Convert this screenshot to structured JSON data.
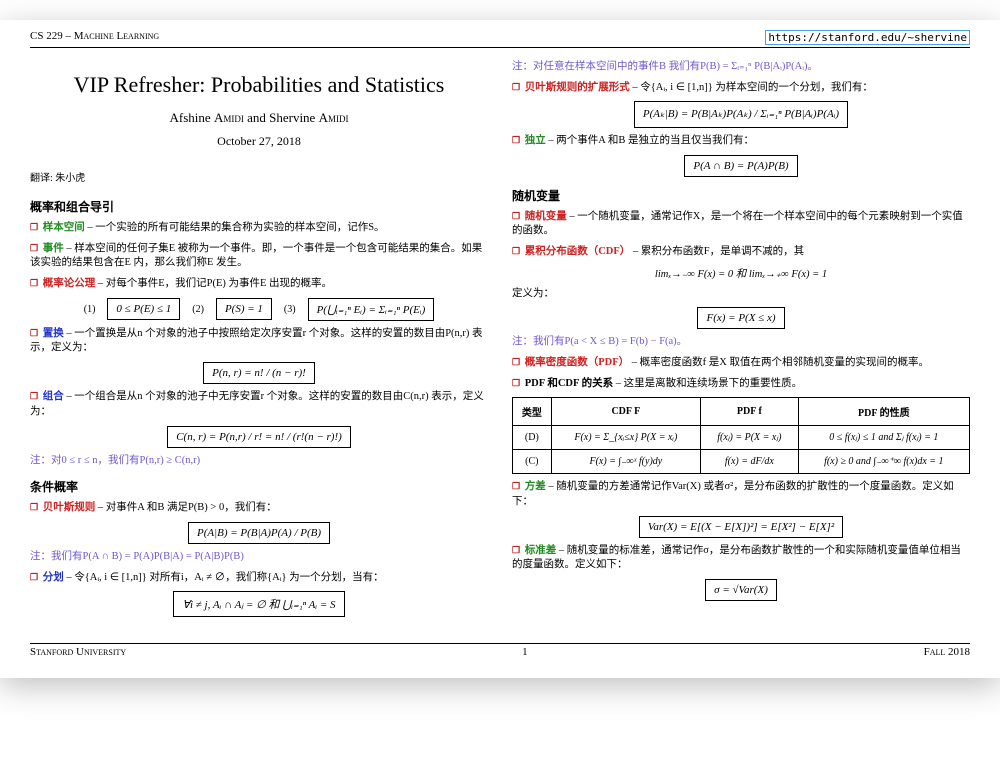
{
  "header": {
    "course": "CS 229 – Machine Learning",
    "url": "https://stanford.edu/~shervine"
  },
  "title": "VIP Refresher: Probabilities and Statistics",
  "authors": "Afshine Amidi and Shervine Amidi",
  "date": "October 27, 2018",
  "translator": "翻译: 朱小虎",
  "left": {
    "sec1": "概率和组合导引",
    "samplespace": {
      "term": "样本空间",
      "text": " – 一个实验的所有可能结果的集合称为实验的样本空间，记作S。"
    },
    "event": {
      "term": "事件",
      "text": " – 样本空间的任何子集E 被称为一个事件。即，一个事件是一个包含可能结果的集合。如果该实验的结果包含在E 内，那么我们称E 发生。"
    },
    "axioms": {
      "term": "概率论公理",
      "text": " – 对每个事件E，我们记P(E) 为事件E 出现的概率。"
    },
    "ax1": "(1)",
    "axbox1": "0 ≤ P(E) ≤ 1",
    "ax2": "(2)",
    "axbox2": "P(S) = 1",
    "ax3": "(3)",
    "axbox3": "P(⋃ᵢ₌₁ⁿ Eᵢ) = Σᵢ₌₁ⁿ P(Eᵢ)",
    "perm": {
      "term": "置换",
      "text": " – 一个置换是从n 个对象的池子中按照给定次序安置r 个对象。这样的安置的数目由P(n,r) 表示，定义为："
    },
    "permbox": "P(n, r) = n! / (n − r)!",
    "comb": {
      "term": "组合",
      "text": " – 一个组合是从n 个对象的池子中无序安置r 个对象。这样的安置的数目由C(n,r) 表示，定义为："
    },
    "combbox": "C(n, r) = P(n,r) / r! = n! / (r!(n − r)!)",
    "note1": "注：对0 ≤ r ≤ n，我们有P(n,r) ≥ C(n,r)",
    "sec2": "条件概率",
    "bayes": {
      "term": "贝叶斯规则",
      "text": " – 对事件A 和B 满足P(B) > 0，我们有："
    },
    "bayesbox": "P(A|B) = P(B|A)P(A) / P(B)",
    "note2": "注：我们有P(A ∩ B) = P(A)P(B|A) = P(A|B)P(B)",
    "partition": {
      "term": "分划",
      "text": " – 令{Aᵢ, i ∈ [1,n]} 对所有i，Aᵢ ≠ ∅，我们称{Aᵢ} 为一个分划，当有："
    },
    "partitionbox": "∀i ≠ j, Aᵢ ∩ Aⱼ = ∅    和    ⋃ᵢ₌₁ⁿ Aᵢ = S"
  },
  "right": {
    "note3": "注：对任意在样本空间中的事件B 我们有P(B) = Σᵢ₌₁ⁿ P(B|Aᵢ)P(Aᵢ)。",
    "extbayes": {
      "term": "贝叶斯规则的扩展形式",
      "text": " – 令{Aᵢ, i ∈ [1,n]} 为样本空间的一个分划，我们有："
    },
    "extbayesbox": "P(Aₖ|B) = P(B|Aₖ)P(Aₖ) / Σᵢ₌₁ⁿ P(B|Aᵢ)P(Aᵢ)",
    "indep": {
      "term": "独立",
      "text": " – 两个事件A 和B 是独立的当且仅当我们有："
    },
    "indepbox": "P(A ∩ B) = P(A)P(B)",
    "sec3": "随机变量",
    "rv": {
      "term": "随机变量",
      "text": " – 一个随机变量，通常记作X，是一个将在一个样本空间中的每个元素映射到一个实值的函数。"
    },
    "cdf": {
      "term": "累积分布函数（CDF）",
      "text": " – 累积分布函数F，是单调不减的，其"
    },
    "cdflim": "limₓ→₋∞ F(x) = 0    和    limₓ→₊∞ F(x) = 1",
    "cdfdef": "定义为：",
    "cdfbox": "F(x) = P(X ≤ x)",
    "note4": "注：我们有P(a < X ≤ B) = F(b) − F(a)。",
    "pdf": {
      "term": "概率密度函数（PDF）",
      "text": " – 概率密度函数f 是X 取值在两个相邻随机变量的实现间的概率。"
    },
    "rel": {
      "term": "PDF 和CDF 的关系",
      "text": " – 这里是离散和连续场景下的重要性质。"
    },
    "tbl": {
      "h1": "类型",
      "h2": "CDF F",
      "h3": "PDF f",
      "h4": "PDF 的性质",
      "r1c1": "(D)",
      "r1c2": "F(x) = Σ_{xᵢ≤x} P(X = xᵢ)",
      "r1c3": "f(xⱼ) = P(X = xⱼ)",
      "r1c4": "0 ≤ f(xⱼ) ≤ 1 and Σⱼ f(xⱼ) = 1",
      "r2c1": "(C)",
      "r2c2": "F(x) = ∫₋∞ˣ f(y)dy",
      "r2c3": "f(x) = dF/dx",
      "r2c4": "f(x) ≥ 0 and ∫₋∞⁺∞ f(x)dx = 1"
    },
    "var": {
      "term": "方差",
      "text": " – 随机变量的方差通常记作Var(X) 或者σ²，是分布函数的扩散性的一个度量函数。定义如下："
    },
    "varbox": "Var(X) = E[(X − E[X])²] = E[X²] − E[X]²",
    "std": {
      "term": "标准差",
      "text": " – 随机变量的标准差，通常记作σ，是分布函数扩散性的一个和实际随机变量值单位相当的度量函数。定义如下："
    },
    "stdbox": "σ = √Var(X)"
  },
  "footer": {
    "left": "Stanford University",
    "center": "1",
    "right": "Fall 2018"
  }
}
